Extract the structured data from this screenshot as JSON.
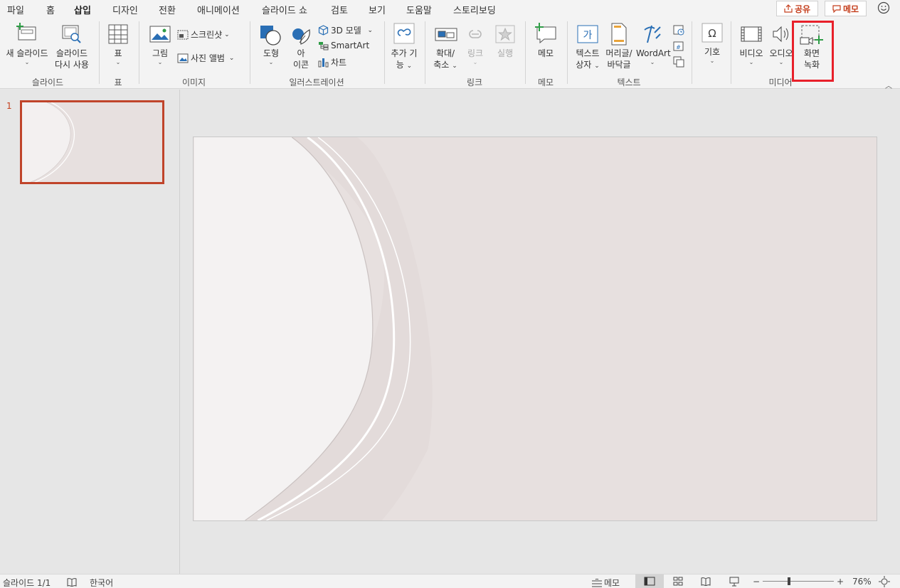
{
  "menu": {
    "tabs": [
      "파일",
      "홈",
      "삽입",
      "디자인",
      "전환",
      "애니메이션",
      "슬라이드 쇼",
      "검토",
      "보기",
      "도움말",
      "스토리보딩"
    ],
    "active_tab": "삽입",
    "share": "공유",
    "memo": "메모"
  },
  "ribbon": {
    "slides": {
      "new_slide": "새 슬라이드",
      "reuse_1": "슬라이드",
      "reuse_2": "다시 사용",
      "group": "슬라이드"
    },
    "tables": {
      "table": "표",
      "group": "표"
    },
    "images": {
      "picture": "그림",
      "screenshot": "스크린샷",
      "album": "사진 앨범",
      "group": "이미지"
    },
    "illustrations": {
      "shapes": "도형",
      "icons_1": "아",
      "icons_2": "이콘",
      "model3d": "3D 모델",
      "smartart": "SmartArt",
      "chart": "차트",
      "group": "일러스트레이션"
    },
    "addins": {
      "label_1": "추가 기",
      "label_2": "능"
    },
    "links": {
      "zoom_1": "확대/",
      "zoom_2": "축소",
      "link": "링크",
      "action": "실행",
      "group": "링크"
    },
    "comments": {
      "comment": "메모",
      "group": "메모"
    },
    "text": {
      "textbox_1": "텍스트",
      "textbox_2": "상자",
      "header_1": "머리글/",
      "header_2": "바닥글",
      "wordart": "WordArt",
      "group": "텍스트"
    },
    "symbols": {
      "symbol": "기호"
    },
    "media": {
      "video": "비디오",
      "audio": "오디오",
      "record_1": "화면",
      "record_2": "녹화",
      "group": "미디어"
    }
  },
  "thumbnails": {
    "number": "1"
  },
  "status": {
    "slide_count": "슬라이드 1/1",
    "language": "한국어",
    "notes": "메모",
    "zoom_minus": "−",
    "zoom_plus": "+",
    "zoom": "76%"
  },
  "colors": {
    "accent": "#b7472a",
    "highlight": "#e8202a",
    "slide_bg": "#e7e0df"
  }
}
